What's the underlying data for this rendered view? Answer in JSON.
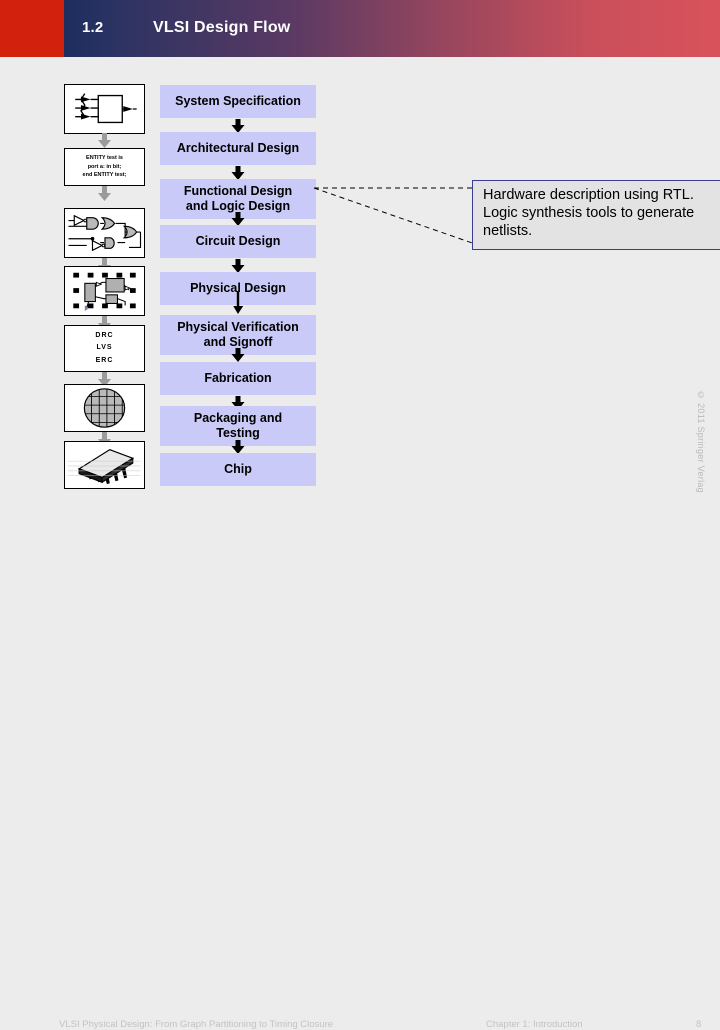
{
  "header": {
    "section_number": "1.2",
    "title": "VLSI Design Flow",
    "red_block_color": "#d2210d",
    "gradient_start_color": "#1d2d5e",
    "gradient_end_color": "#d9525b"
  },
  "flow": {
    "box_fill_color": "#c9caf7",
    "steps": [
      {
        "label": "System Specification"
      },
      {
        "label": "Architectural Design"
      },
      {
        "label": "Functional Design and Logic Design"
      },
      {
        "label": "Circuit Design"
      },
      {
        "label": "Physical Design"
      },
      {
        "label": "Physical Verification and Signoff"
      },
      {
        "label": "Fabrication"
      },
      {
        "label": "Packaging and Testing"
      },
      {
        "label": "Chip"
      }
    ],
    "step_lines": {
      "functional": [
        "Functional Design",
        "and Logic Design"
      ],
      "verification": [
        "Physical Verification",
        "and Signoff"
      ],
      "packaging": [
        "Packaging and",
        "Testing"
      ]
    }
  },
  "icons": {
    "block_diagram": "block-diagram-icon",
    "hdl_code": "hdl-code-icon",
    "logic_gates": "logic-gate-schematic-icon",
    "layout": "floorplan-layout-icon",
    "verification": "drc-lvs-erc-icon",
    "wafer": "wafer-icon",
    "package": "chip-package-icon",
    "hdl_code_lines": [
      "ENTITY test is",
      "port a: in bit;",
      "end ENTITY test;"
    ],
    "verification_lines": [
      "DRC",
      "LVS",
      "ERC"
    ]
  },
  "callout": {
    "text": "Hardware description using RTL. Logic synthesis tools to generate netlists.",
    "border_color": "#3c3c96",
    "fill_color": "#e3e3e3"
  },
  "footer": {
    "book_title": "VLSI Physical Design: From Graph Partitioning to Timing Closure",
    "chapter": "Chapter 1: Introduction",
    "page_number": "8",
    "copyright": "© 2011 Springer Verlag"
  }
}
